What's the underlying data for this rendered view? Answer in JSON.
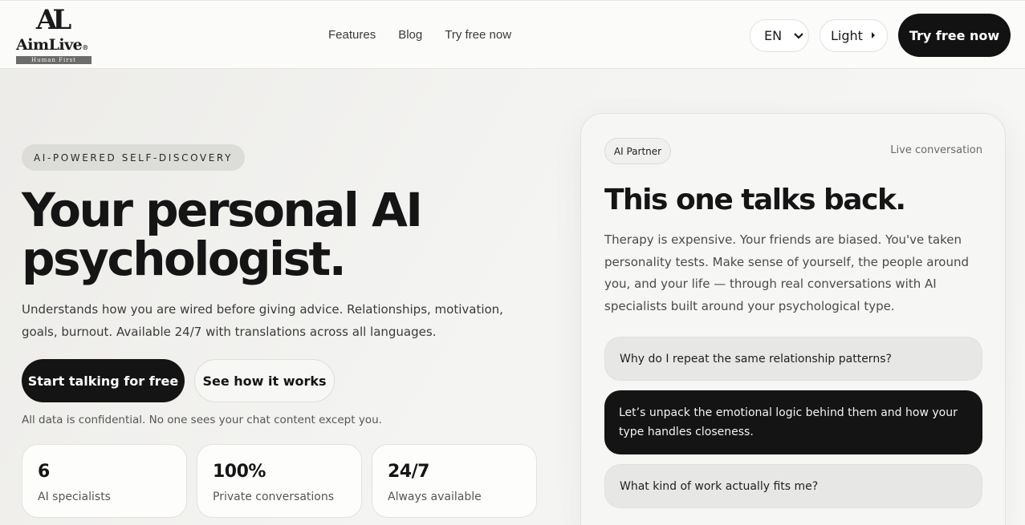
{
  "brand": {
    "mark": "AL",
    "name": "AimLive",
    "registered": "®",
    "tagline": "Human First"
  },
  "nav": {
    "items": [
      "Features",
      "Blog",
      "Try free now"
    ]
  },
  "header": {
    "language": "EN",
    "theme": "Light",
    "cta": "Try free now"
  },
  "hero": {
    "eyebrow": "AI-POWERED SELF-DISCOVERY",
    "title_line1": "Your personal AI",
    "title_line2": "psychologist.",
    "subtitle": "Understands how you are wired before giving advice. Relationships, motivation, goals, burnout. Available 24/7 with translations across all languages.",
    "primary_cta": "Start talking for free",
    "secondary_cta": "See how it works",
    "note": "All data is confidential. No one sees your chat content except you."
  },
  "stats": [
    {
      "value": "6",
      "label": "AI specialists"
    },
    {
      "value": "100%",
      "label": "Private conversations"
    },
    {
      "value": "24/7",
      "label": "Always available"
    }
  ],
  "card": {
    "badge": "AI Partner",
    "status": "Live conversation",
    "title": "This one talks back.",
    "body": "Therapy is expensive. Your friends are biased. You've taken personality tests. Make sense of yourself, the people around you, and your life — through real conversations with AI specialists built around your psychological type.",
    "messages": [
      {
        "role": "user",
        "text": "Why do I repeat the same relationship patterns?"
      },
      {
        "role": "ai",
        "text": "Let’s unpack the emotional logic behind them and how your type handles closeness."
      },
      {
        "role": "user",
        "text": "What kind of work actually fits me?"
      }
    ]
  }
}
